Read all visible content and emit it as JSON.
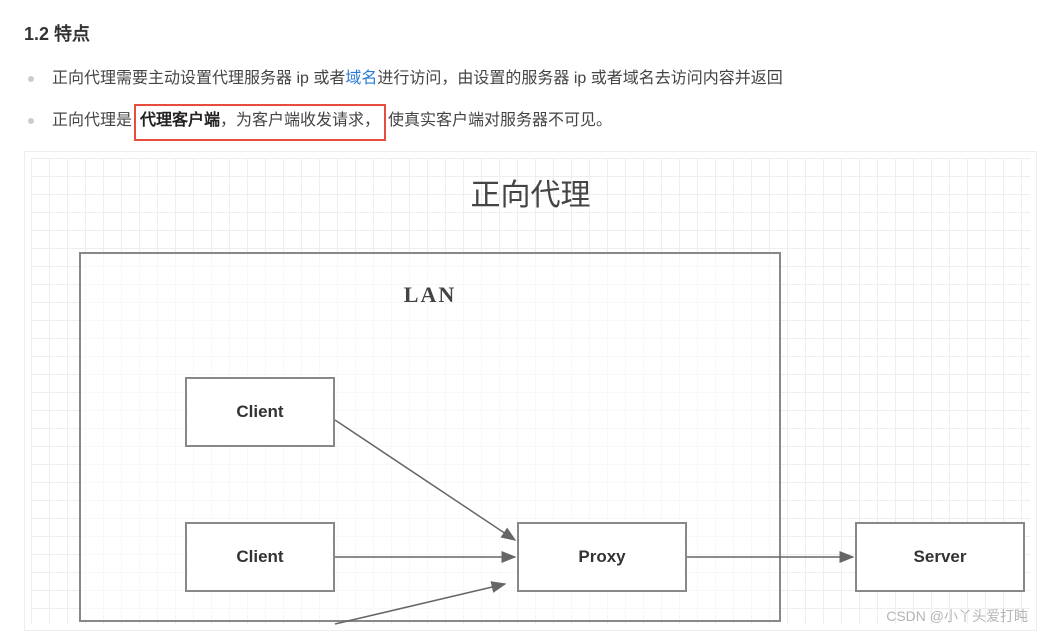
{
  "section_title": "1.2 特点",
  "bullet1": {
    "pre": "正向代理需要主动设置代理服务器 ip 或者",
    "link": "域名",
    "post": "进行访问，由设置的服务器 ip 或者域名去访问内容并返回"
  },
  "bullet2": {
    "pre": "正向代理是",
    "bold": "代理客户端",
    "mid": "，为客户端收发请求，",
    "post": "使真实客户端对服务器不可见。"
  },
  "diagram": {
    "title": "正向代理",
    "lan_label": "LAN",
    "client_label": "Client",
    "proxy_label": "Proxy",
    "server_label": "Server"
  },
  "watermark": {
    "prefix": "CSDN @",
    "author": "小丫头爱打盹"
  }
}
